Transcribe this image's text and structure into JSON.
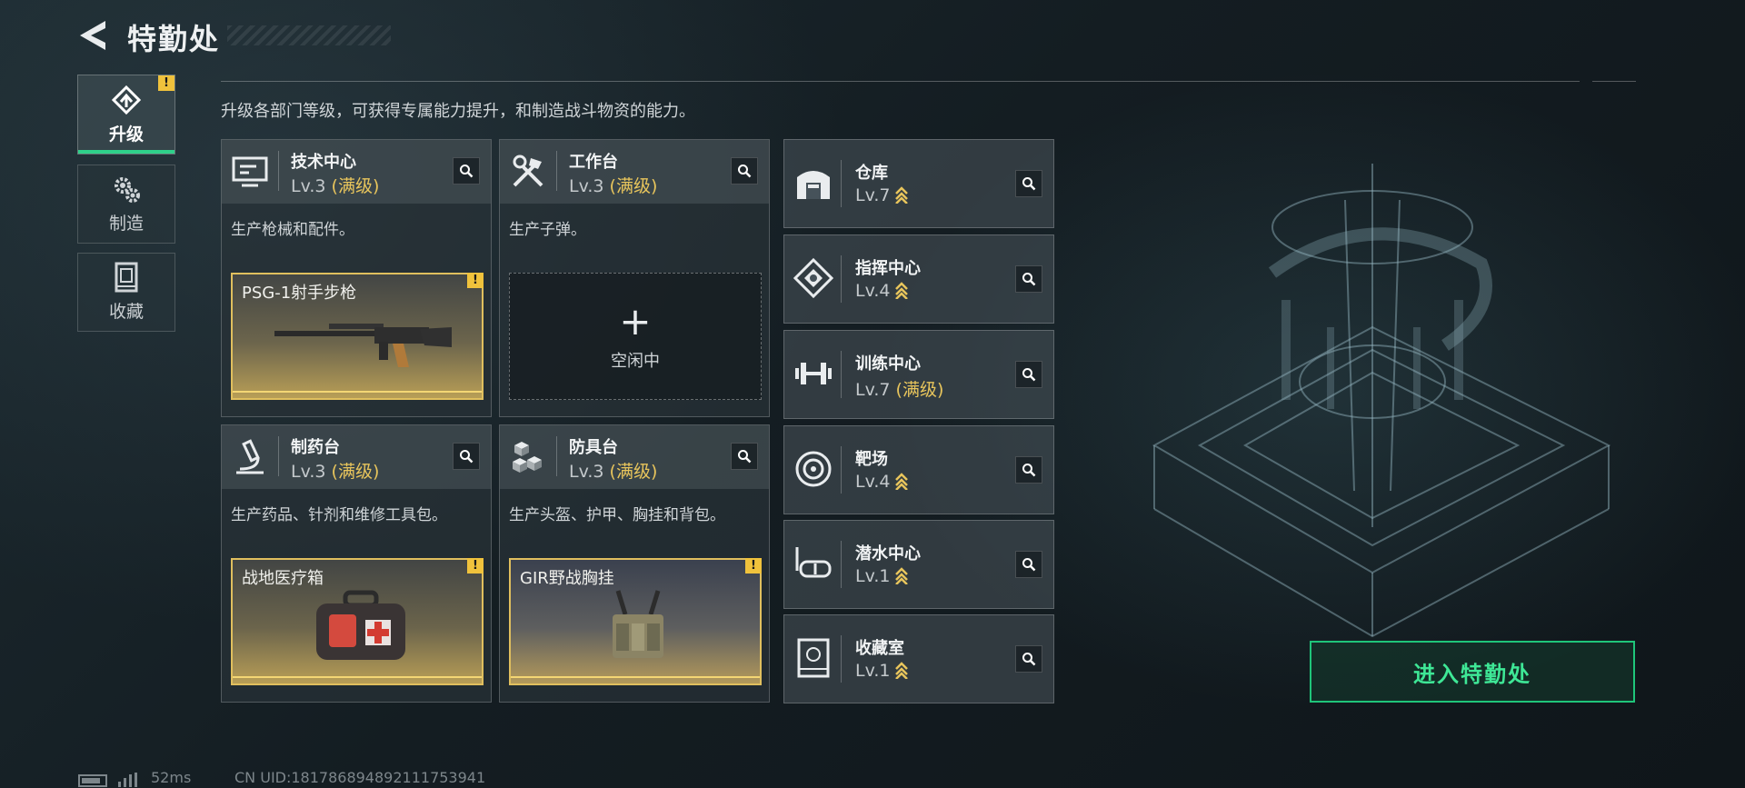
{
  "header": {
    "title": "特勤处"
  },
  "nav": [
    {
      "label": "升级",
      "icon": "upgrade-icon",
      "active": true,
      "warn": "!"
    },
    {
      "label": "制造",
      "icon": "gears-icon",
      "active": false
    },
    {
      "label": "收藏",
      "icon": "collection-icon",
      "active": false
    }
  ],
  "intro": "升级各部门等级，可获得专属能力提升，和制造战斗物资的能力。",
  "cards": [
    {
      "name": "技术中心",
      "level": "Lv.3",
      "max": "(满级)",
      "desc": "生产枪械和配件。",
      "icon": "computer-icon",
      "slot": {
        "item": "PSG-1射手步枪",
        "warn": "!"
      }
    },
    {
      "name": "工作台",
      "level": "Lv.3",
      "max": "(满级)",
      "desc": "生产子弹。",
      "icon": "tools-icon",
      "slot": {
        "plus": "+",
        "status": "空闲中"
      }
    },
    {
      "name": "制药台",
      "level": "Lv.3",
      "max": "(满级)",
      "desc": "生产药品、针剂和维修工具包。",
      "icon": "microscope-icon",
      "slot": {
        "item": "战地医疗箱",
        "warn": "!"
      }
    },
    {
      "name": "防具台",
      "level": "Lv.3",
      "max": "(满级)",
      "desc": "生产头盔、护甲、胸挂和背包。",
      "icon": "cubes-icon",
      "slot": {
        "item": "GIR野战胸挂",
        "warn": "!"
      }
    }
  ],
  "departments": [
    {
      "name": "仓库",
      "level": "Lv.7",
      "max": "",
      "upgrade_indicator": true,
      "icon": "warehouse-icon"
    },
    {
      "name": "指挥中心",
      "level": "Lv.4",
      "max": "",
      "upgrade_indicator": true,
      "icon": "command-icon"
    },
    {
      "name": "训练中心",
      "level": "Lv.7",
      "max": "(满级)",
      "upgrade_indicator": false,
      "icon": "dumbbell-icon"
    },
    {
      "name": "靶场",
      "level": "Lv.4",
      "max": "",
      "upgrade_indicator": true,
      "icon": "target-icon"
    },
    {
      "name": "潜水中心",
      "level": "Lv.1",
      "max": "",
      "upgrade_indicator": true,
      "icon": "goggles-icon"
    },
    {
      "name": "收藏室",
      "level": "Lv.1",
      "max": "",
      "upgrade_indicator": true,
      "icon": "vault-icon"
    }
  ],
  "enter_button": "进入特勤处",
  "status": {
    "ping": "52ms",
    "uid": "CN UID:181786894892111753941"
  },
  "colors": {
    "accent_green": "#1fc57a",
    "gold": "#e8c55c",
    "warn": "#f0c23c"
  }
}
